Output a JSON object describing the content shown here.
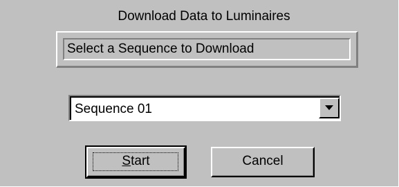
{
  "dialog": {
    "title": "Download Data to Luminaires",
    "status_text": "Select a Sequence to Download"
  },
  "sequence_select": {
    "selected": "Sequence 01",
    "dropdown_icon": "triangle-down"
  },
  "buttons": {
    "start": {
      "mnemonic": "S",
      "rest": "tart"
    },
    "cancel": "Cancel"
  },
  "colors": {
    "face": "#c0c0c0",
    "highlight": "#ffffff",
    "shadow": "#808080",
    "dark_shadow": "#000000",
    "field": "#ffffff"
  }
}
